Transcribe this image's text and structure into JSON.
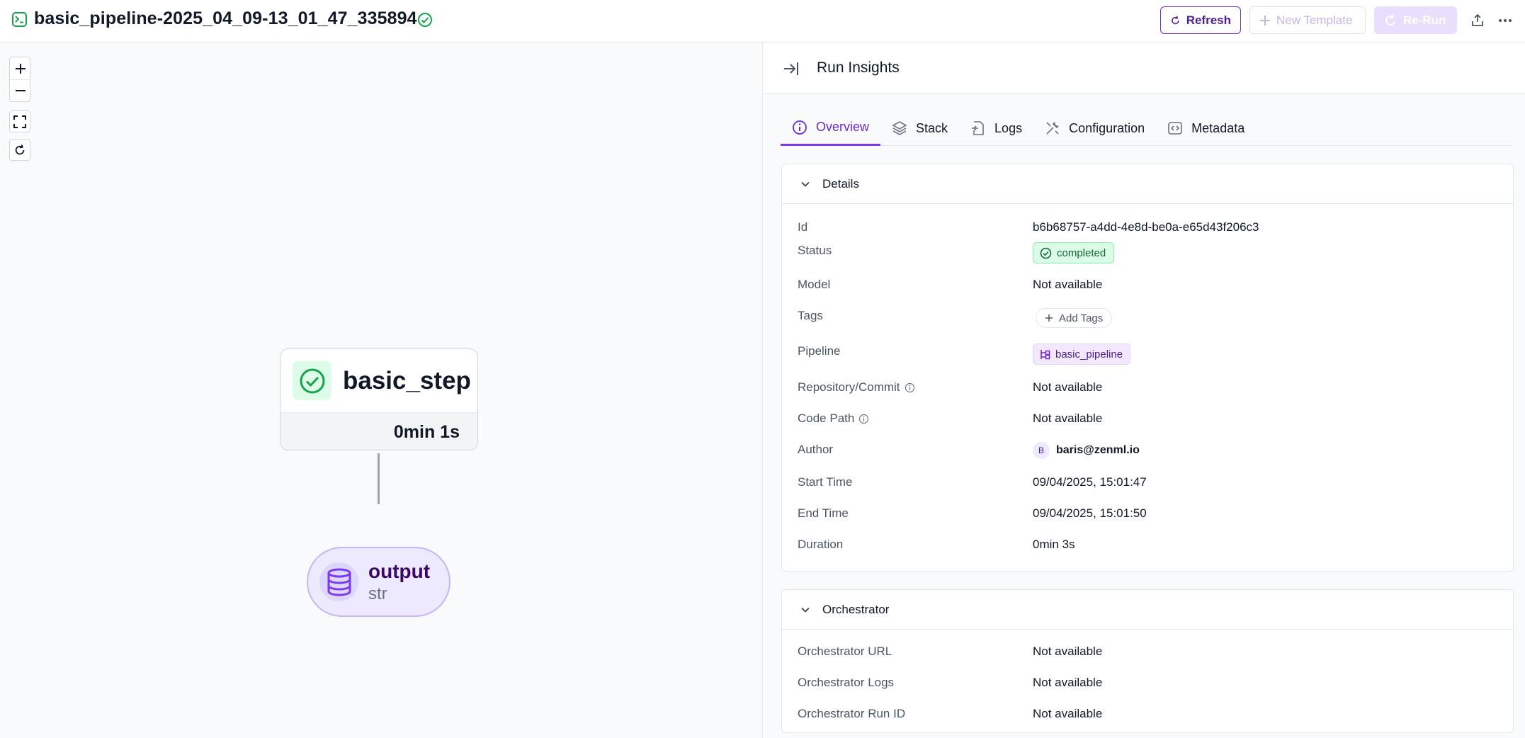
{
  "header": {
    "run_title": "basic_pipeline-2025_04_09-13_01_47_335894",
    "refresh_label": "Refresh",
    "new_template_label": "New Template",
    "rerun_label": "Re-Run"
  },
  "canvas": {
    "controls": [
      "zoom-in",
      "zoom-out",
      "fit-view",
      "reset"
    ],
    "step": {
      "name": "basic_step",
      "duration": "0min 1s",
      "status": "completed"
    },
    "artifact": {
      "name": "output",
      "type": "str"
    }
  },
  "panel": {
    "title": "Run Insights",
    "tabs": [
      {
        "label": "Overview",
        "icon": "info-icon",
        "active": true
      },
      {
        "label": "Stack",
        "icon": "layers-icon",
        "active": false
      },
      {
        "label": "Logs",
        "icon": "logs-icon",
        "active": false
      },
      {
        "label": "Configuration",
        "icon": "tools-icon",
        "active": false
      },
      {
        "label": "Metadata",
        "icon": "code-icon",
        "active": false
      }
    ],
    "details": {
      "title": "Details",
      "rows": {
        "id": {
          "key": "Id",
          "value": "b6b68757-a4dd-4e8d-be0a-e65d43f206c3"
        },
        "status": {
          "key": "Status",
          "value": "completed"
        },
        "model": {
          "key": "Model",
          "value": "Not available"
        },
        "tags": {
          "key": "Tags",
          "value": "Add Tags"
        },
        "pipeline": {
          "key": "Pipeline",
          "value": "basic_pipeline"
        },
        "repository": {
          "key": "Repository/Commit",
          "value": "Not available"
        },
        "code_path": {
          "key": "Code Path",
          "value": "Not available"
        },
        "author": {
          "key": "Author",
          "initial": "B",
          "value": "baris@zenml.io"
        },
        "start_time": {
          "key": "Start Time",
          "value": "09/04/2025, 15:01:47"
        },
        "end_time": {
          "key": "End Time",
          "value": "09/04/2025, 15:01:50"
        },
        "duration": {
          "key": "Duration",
          "value": "0min 3s"
        }
      }
    },
    "orchestrator": {
      "title": "Orchestrator",
      "rows": {
        "url": {
          "key": "Orchestrator URL",
          "value": "Not available"
        },
        "logs": {
          "key": "Orchestrator Logs",
          "value": "Not available"
        },
        "run_id": {
          "key": "Orchestrator Run ID",
          "value": "Not available"
        }
      }
    }
  },
  "colors": {
    "accent": "#7c3aed",
    "success": "#16a34a",
    "border": "#e5e7eb"
  }
}
